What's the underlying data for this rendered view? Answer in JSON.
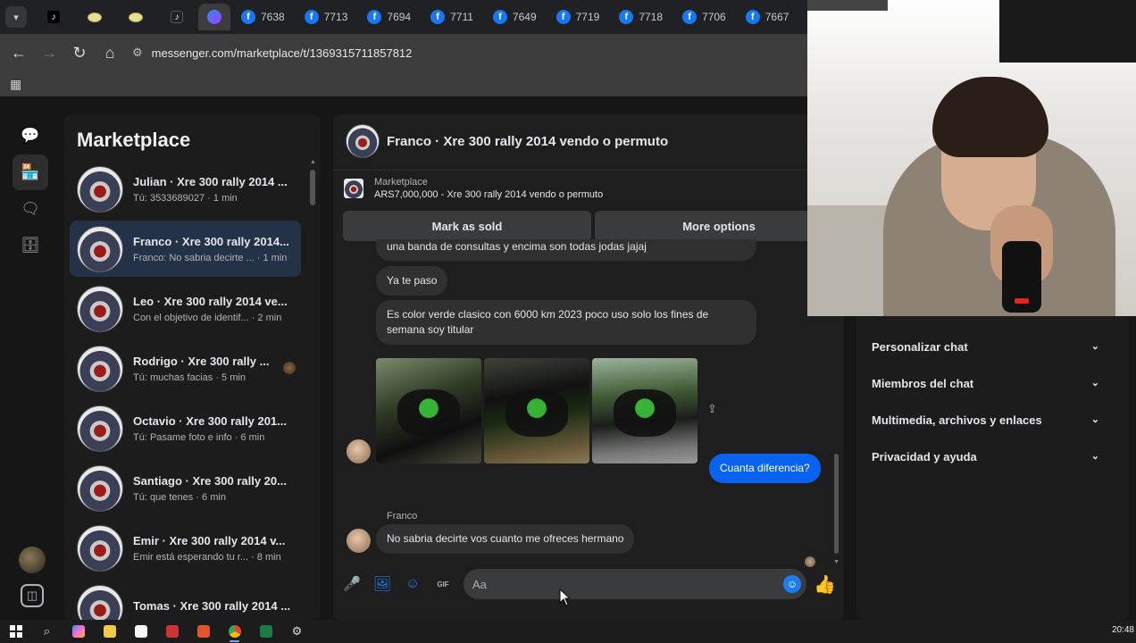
{
  "browser": {
    "tabs": [
      {
        "icon": "tiktok-icon",
        "label": ""
      },
      {
        "icon": "egg-icon",
        "label": ""
      },
      {
        "icon": "egg-icon",
        "label": ""
      },
      {
        "icon": "tiktok-icon",
        "label": ""
      },
      {
        "icon": "messenger-icon",
        "label": "",
        "active": true
      },
      {
        "icon": "facebook-icon",
        "label": "7638"
      },
      {
        "icon": "facebook-icon",
        "label": "7713"
      },
      {
        "icon": "facebook-icon",
        "label": "7694"
      },
      {
        "icon": "facebook-icon",
        "label": "7711"
      },
      {
        "icon": "facebook-icon",
        "label": "7649"
      },
      {
        "icon": "facebook-icon",
        "label": "7719"
      },
      {
        "icon": "facebook-icon",
        "label": "7718"
      },
      {
        "icon": "facebook-icon",
        "label": "7706"
      },
      {
        "icon": "facebook-icon",
        "label": "7667"
      }
    ],
    "url": "messenger.com/marketplace/t/1369315711857812"
  },
  "sidebar": {
    "title": "Marketplace",
    "conversations": [
      {
        "name": "Julian · Xre 300 rally 2014 ...",
        "preview": "Tú: 3533689027 · 1 min",
        "active": false
      },
      {
        "name": "Franco · Xre 300 rally 2014...",
        "preview": "Franco: No sabria decirte ... · 1 min",
        "active": true
      },
      {
        "name": "Leo · Xre 300 rally 2014 ve...",
        "preview": "Con el objetivo de identif... · 2 min",
        "active": false
      },
      {
        "name": "Rodrigo · Xre 300 rally ...",
        "preview": "Tú: muchas facias · 5 min",
        "active": false,
        "read_avatar": true
      },
      {
        "name": "Octavio · Xre 300 rally 201...",
        "preview": "Tú: Pasame foto e info · 6 min",
        "active": false
      },
      {
        "name": "Santiago · Xre 300 rally 20...",
        "preview": "Tú: que tenes · 6 min",
        "active": false
      },
      {
        "name": "Emir · Xre 300 rally 2014 v...",
        "preview": "Emir está esperando tu r... · 8 min",
        "active": false
      },
      {
        "name": "Tomas · Xre 300 rally 2014 ...",
        "preview": "",
        "active": false
      }
    ]
  },
  "chat": {
    "title": "Franco · Xre 300 rally 2014 vendo o permuto",
    "listing_label": "Marketplace",
    "listing_desc": "ARS7,000,000 - Xre 300 rally 2014 vendo o permuto",
    "mark_sold": "Mark as sold",
    "more_options": "More options",
    "messages": {
      "clipped": "una banda de consultas y encima son todas jodas jajaj",
      "m1": "Ya te paso",
      "m2": "Es color verde clasico con 6000 km 2023 poco uso solo los fines de semana soy titular",
      "mine": "Cuanta diferencia?",
      "sender": "Franco",
      "m3": "No sabria decirte vos cuanto me ofreces hermano"
    },
    "composer_placeholder": "Aa"
  },
  "details": {
    "items": [
      "Personalizar chat",
      "Miembros del chat",
      "Multimedia, archivos y enlaces",
      "Privacidad y ayuda"
    ]
  },
  "taskbar": {
    "clock": "20:48"
  },
  "colors": {
    "accent": "#0a63f0",
    "active_conversation": "#243247"
  }
}
